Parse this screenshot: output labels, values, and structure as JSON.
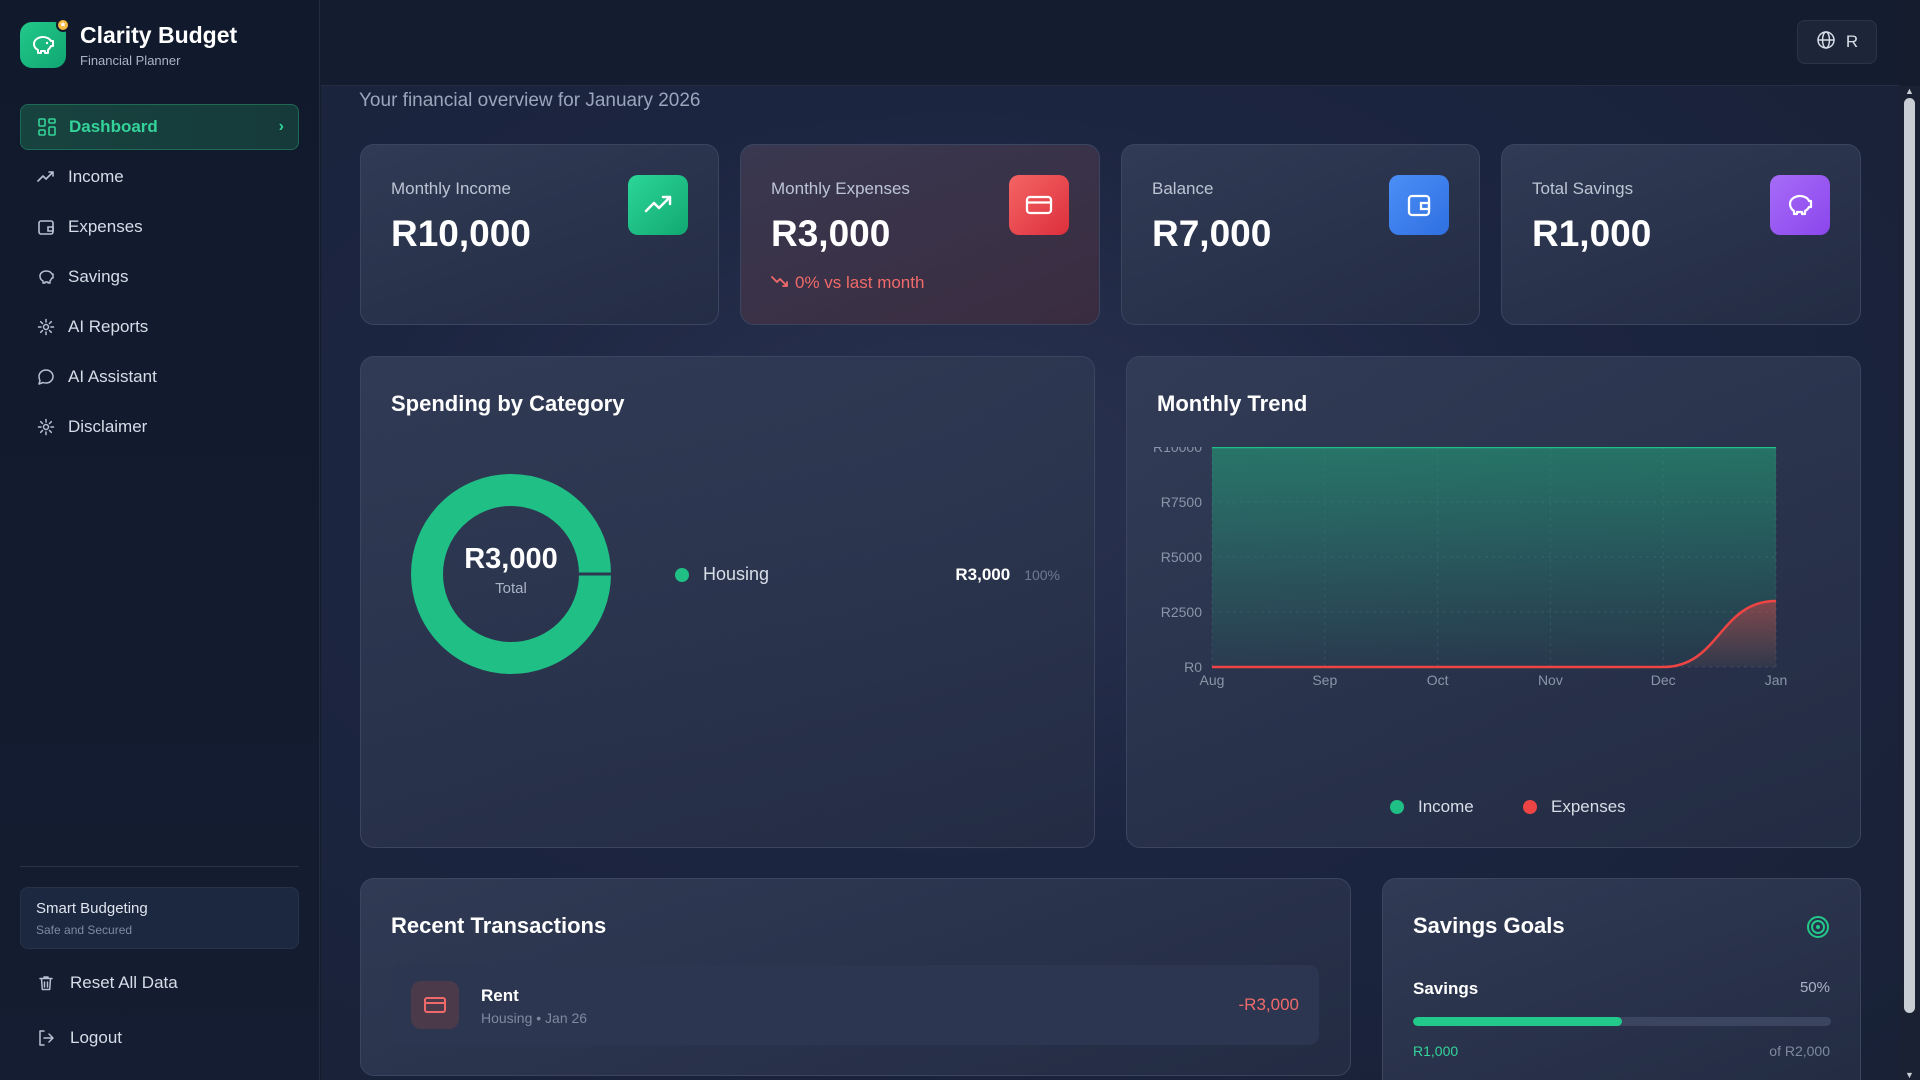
{
  "brand": {
    "title": "Clarity Budget",
    "subtitle": "Financial Planner"
  },
  "nav": [
    {
      "label": "Dashboard",
      "icon": "grid-icon",
      "active": true
    },
    {
      "label": "Income",
      "icon": "trend-icon"
    },
    {
      "label": "Expenses",
      "icon": "wallet-icon"
    },
    {
      "label": "Savings",
      "icon": "piggy-icon"
    },
    {
      "label": "AI Reports",
      "icon": "gear-icon"
    },
    {
      "label": "AI Assistant",
      "icon": "chat-icon"
    },
    {
      "label": "Disclaimer",
      "icon": "gear-icon"
    }
  ],
  "smart": {
    "title": "Smart Budgeting",
    "subtitle": "Safe and Secured"
  },
  "actions": {
    "reset": "Reset All Data",
    "logout": "Logout"
  },
  "topbar": {
    "lang_label": "R"
  },
  "page": {
    "subtitle": "Your financial overview for January 2026"
  },
  "stats": [
    {
      "label": "Monthly Income",
      "value": "R10,000",
      "color": "#22c98a"
    },
    {
      "label": "Monthly Expenses",
      "value": "R3,000",
      "change": "0% vs last month",
      "color": "#ef4b4b"
    },
    {
      "label": "Balance",
      "value": "R7,000",
      "color": "#3b82f6"
    },
    {
      "label": "Total Savings",
      "value": "R1,000",
      "color": "#9b5cf6"
    }
  ],
  "spending": {
    "title": "Spending by Category",
    "total": "R3,000",
    "total_label": "Total",
    "items": [
      {
        "name": "Housing",
        "amount": "R3,000",
        "pct": "100%",
        "color": "#1fbf85"
      }
    ]
  },
  "chart_data": {
    "type": "area",
    "title": "Monthly Trend",
    "x": [
      "Aug",
      "Sep",
      "Oct",
      "Nov",
      "Dec",
      "Jan"
    ],
    "yticks": [
      "R0",
      "R2500",
      "R5000",
      "R7500",
      "R10000"
    ],
    "ylim": [
      0,
      10000
    ],
    "series": [
      {
        "name": "Income",
        "values": [
          10000,
          10000,
          10000,
          10000,
          10000,
          10000
        ],
        "color": "#1fbf85"
      },
      {
        "name": "Expenses",
        "values": [
          0,
          0,
          0,
          0,
          0,
          3000
        ],
        "color": "#ef4444"
      }
    ],
    "grid": true,
    "legend": "bottom"
  },
  "transactions": {
    "title": "Recent Transactions",
    "items": [
      {
        "name": "Rent",
        "meta": "Housing • Jan 26",
        "amount": "-R3,000"
      }
    ]
  },
  "goals": {
    "title": "Savings Goals",
    "items": [
      {
        "name": "Savings",
        "pct": "50%",
        "progress": 0.5,
        "current": "R1,000",
        "target": "of R2,000"
      }
    ]
  }
}
